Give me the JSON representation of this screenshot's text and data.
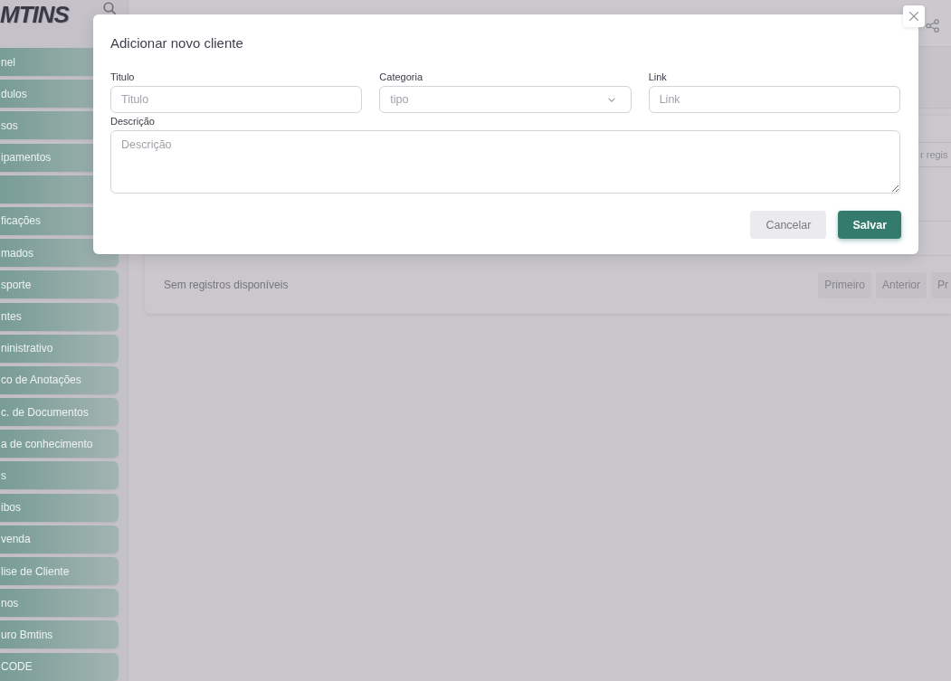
{
  "logo": {
    "text": "MTINS"
  },
  "sidebar": {
    "items": [
      {
        "kind": "link",
        "label": "nel"
      },
      {
        "kind": "link",
        "label": "dulos"
      },
      {
        "kind": "link",
        "label": "sos"
      },
      {
        "kind": "link",
        "label": "ipamentos"
      },
      {
        "kind": "empty"
      },
      {
        "kind": "link",
        "label": "ficações"
      },
      {
        "kind": "link",
        "label": "mados"
      },
      {
        "kind": "link",
        "label": "sporte"
      },
      {
        "kind": "link",
        "label": "ntes"
      },
      {
        "kind": "link",
        "label": "ninistrativo"
      },
      {
        "kind": "link",
        "label": "co de Anotações"
      },
      {
        "kind": "link",
        "label": "c. de Documentos"
      },
      {
        "kind": "link",
        "label": "a de conhecimento"
      },
      {
        "kind": "link",
        "label": "s"
      },
      {
        "kind": "link",
        "label": "ibos"
      },
      {
        "kind": "link",
        "label": "venda"
      },
      {
        "kind": "link",
        "label": "lise de Cliente"
      },
      {
        "kind": "link",
        "label": "nos"
      },
      {
        "kind": "link",
        "label": "uro Bmtins"
      },
      {
        "kind": "link",
        "label": "CODE"
      }
    ]
  },
  "records": {
    "search": {
      "placeholder": "r regis"
    },
    "empty_message": "Sem registros disponíveis",
    "pagination": [
      {
        "label": "Primeiro",
        "disabled": true
      },
      {
        "label": "Anterior",
        "disabled": true
      },
      {
        "label": "Pr",
        "disabled": true
      }
    ]
  },
  "dialog": {
    "title": "Adicionar novo cliente",
    "fields": [
      {
        "kind": "text",
        "label": "Titulo",
        "placeholder": "Titulo"
      },
      {
        "kind": "select",
        "label": "Categoria",
        "placeholder": "tipo"
      },
      {
        "kind": "text",
        "label": "Link",
        "placeholder": "Link"
      },
      {
        "kind": "textarea",
        "label": "Descrição",
        "placeholder": "Descrição"
      }
    ],
    "buttons": [
      {
        "kind": "secondary",
        "label": "Cancelar"
      },
      {
        "kind": "primary",
        "label": "Salvar"
      }
    ]
  }
}
